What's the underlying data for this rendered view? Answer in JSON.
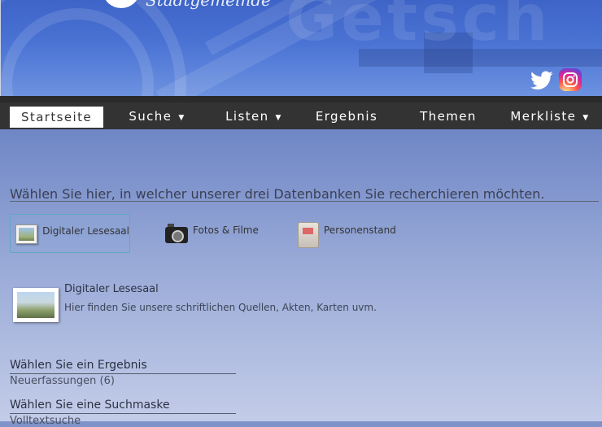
{
  "header": {
    "subtitle": "Stadtgemeinde",
    "social": [
      "twitter-icon",
      "instagram-icon"
    ]
  },
  "nav": {
    "items": [
      {
        "label": "Startseite",
        "active": true,
        "dropdown": false
      },
      {
        "label": "Suche",
        "active": false,
        "dropdown": true
      },
      {
        "label": "Listen",
        "active": false,
        "dropdown": true
      },
      {
        "label": "Ergebnis",
        "active": false,
        "dropdown": false
      },
      {
        "label": "Themen",
        "active": false,
        "dropdown": false
      },
      {
        "label": "Merkliste",
        "active": false,
        "dropdown": true
      }
    ],
    "caret": "▼"
  },
  "main": {
    "intro": "Wählen Sie hier, in welcher unserer drei Datenbanken Sie recherchieren möchten.",
    "databases": [
      {
        "label": "Digitaler Lesesaal",
        "icon": "document-image-icon",
        "selected": true
      },
      {
        "label": "Fotos & Filme",
        "icon": "camera-icon",
        "selected": false
      },
      {
        "label": "Personenstand",
        "icon": "registry-icon",
        "selected": false
      }
    ],
    "detail": {
      "title": "Digitaler Lesesaal",
      "description": "Hier finden Sie unsere schriftlichen Quellen, Akten, Karten uvm."
    },
    "results_section": {
      "title": "Wählen Sie ein Ergebnis",
      "items": [
        "Neuerfassungen (6)"
      ]
    },
    "search_section": {
      "title": "Wählen Sie eine Suchmaske",
      "items": [
        "Volltextsuche"
      ]
    }
  },
  "colors": {
    "nav_bg": "#333333",
    "banner_blue": "#4a73d4",
    "selected_border": "#60a8c0"
  }
}
